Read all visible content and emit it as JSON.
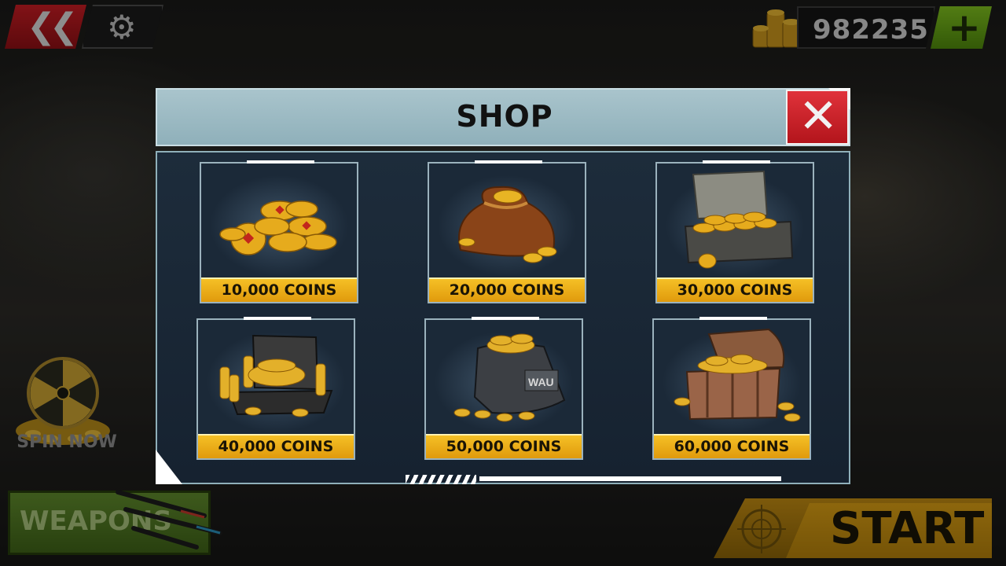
{
  "hud": {
    "coin_balance": "982235",
    "add_label": "+",
    "spin_label": "SPIN NOW",
    "weapons_label": "WEAPONS",
    "start_label": "START"
  },
  "shop": {
    "title": "SHOP",
    "items": [
      {
        "label": "10,000 COINS",
        "image": "coin-pile"
      },
      {
        "label": "20,000 COINS",
        "image": "coin-sack"
      },
      {
        "label": "30,000 COINS",
        "image": "coin-case"
      },
      {
        "label": "40,000 COINS",
        "image": "coin-crate"
      },
      {
        "label": "50,000 COINS",
        "image": "coin-duffel-bag"
      },
      {
        "label": "60,000 COINS",
        "image": "treasure-chest"
      }
    ],
    "bag_text": "WAU"
  },
  "colors": {
    "accent_gold": "#f5c026",
    "close_red": "#e0323a",
    "add_green": "#7fbf1f",
    "panel_blue": "#1d2c3b"
  }
}
